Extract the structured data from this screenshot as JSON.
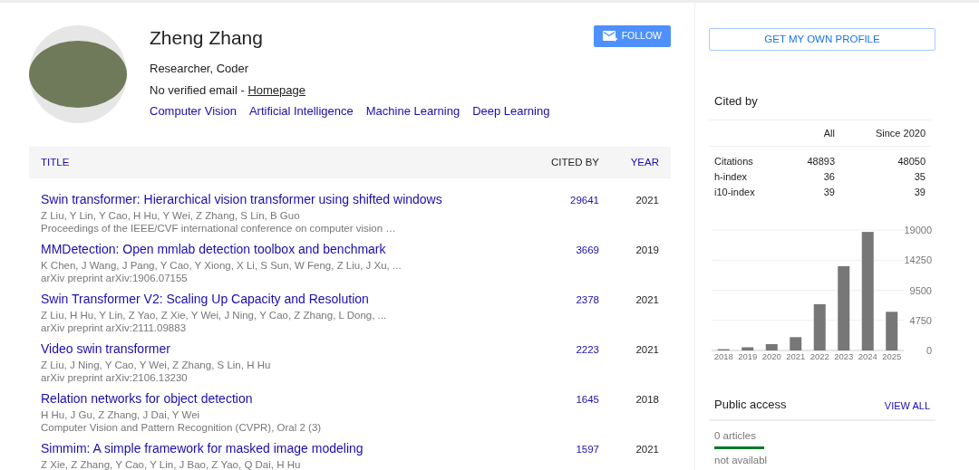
{
  "profile": {
    "name": "Zheng Zhang",
    "affiliation": "Researcher, Coder",
    "email_text": "No verified email - ",
    "homepage_link": "Homepage",
    "interests": [
      "Computer Vision",
      "Artificial Intelligence",
      "Machine Learning",
      "Deep Learning"
    ],
    "follow_button": "FOLLOW"
  },
  "table": {
    "columns": [
      {
        "label": "TITLE",
        "sortable": true
      },
      {
        "label": "CITED BY",
        "sortable": false
      },
      {
        "label": "YEAR",
        "sortable": true
      }
    ],
    "rows": [
      {
        "title": "Swin transformer: Hierarchical vision transformer using shifted windows",
        "authors": "Z Liu, Y Lin, Y Cao, H Hu, Y Wei, Z Zhang, S Lin, B Guo",
        "venue": "Proceedings of the IEEE/CVF international conference on computer vision …",
        "cited_by": "29641",
        "year": "2021"
      },
      {
        "title": "MMDetection: Open mmlab detection toolbox and benchmark",
        "authors": "K Chen, J Wang, J Pang, Y Cao, Y Xiong, X Li, S Sun, W Feng, Z Liu, J Xu, ...",
        "venue": "arXiv preprint arXiv:1906.07155",
        "cited_by": "3669",
        "year": "2019"
      },
      {
        "title": "Swin Transformer V2: Scaling Up Capacity and Resolution",
        "authors": "Z Liu, H Hu, Y Lin, Z Yao, Z Xie, Y Wei, J Ning, Y Cao, Z Zhang, L Dong, ...",
        "venue": "arXiv preprint arXiv:2111.09883",
        "cited_by": "2378",
        "year": "2021"
      },
      {
        "title": "Video swin transformer",
        "authors": "Z Liu, J Ning, Y Cao, Y Wei, Z Zhang, S Lin, H Hu",
        "venue": "arXiv preprint arXiv:2106.13230",
        "cited_by": "2223",
        "year": "2021"
      },
      {
        "title": "Relation networks for object detection",
        "authors": "H Hu, J Gu, Z Zhang, J Dai, Y Wei",
        "venue": "Computer Vision and Pattern Recognition (CVPR), Oral 2 (3)",
        "cited_by": "1645",
        "year": "2018"
      },
      {
        "title": "Simmim: A simple framework for masked image modeling",
        "authors": "Z Xie, Z Zhang, Y Cao, Y Lin, J Bao, Z Yao, Q Dai, H Hu",
        "cited_by": "1597",
        "year": "2021"
      }
    ]
  },
  "sidebar": {
    "profile_button": "GET MY OWN PROFILE",
    "cited_by": {
      "title": "Cited by",
      "columns": [
        "All",
        "Since 2020"
      ],
      "rows": [
        {
          "label": "Citations",
          "all": "48893",
          "since": "48050"
        },
        {
          "label": "h-index",
          "all": "36",
          "since": "35"
        },
        {
          "label": "i10-index",
          "all": "39",
          "since": "39"
        }
      ]
    },
    "chart_data": {
      "type": "bar",
      "categories": [
        "2018",
        "2019",
        "2020",
        "2021",
        "2022",
        "2023",
        "2024",
        "2025"
      ],
      "values": [
        200,
        500,
        1000,
        2100,
        7300,
        13300,
        18700,
        6100
      ],
      "grid": true,
      "ylim": [
        0,
        19000
      ],
      "yticks": [
        0,
        4750,
        9500,
        14250,
        19000
      ]
    },
    "public_access": {
      "title": "Public access",
      "view_all": "VIEW ALL",
      "available": "0 articles",
      "not_available": "not availabl"
    }
  }
}
